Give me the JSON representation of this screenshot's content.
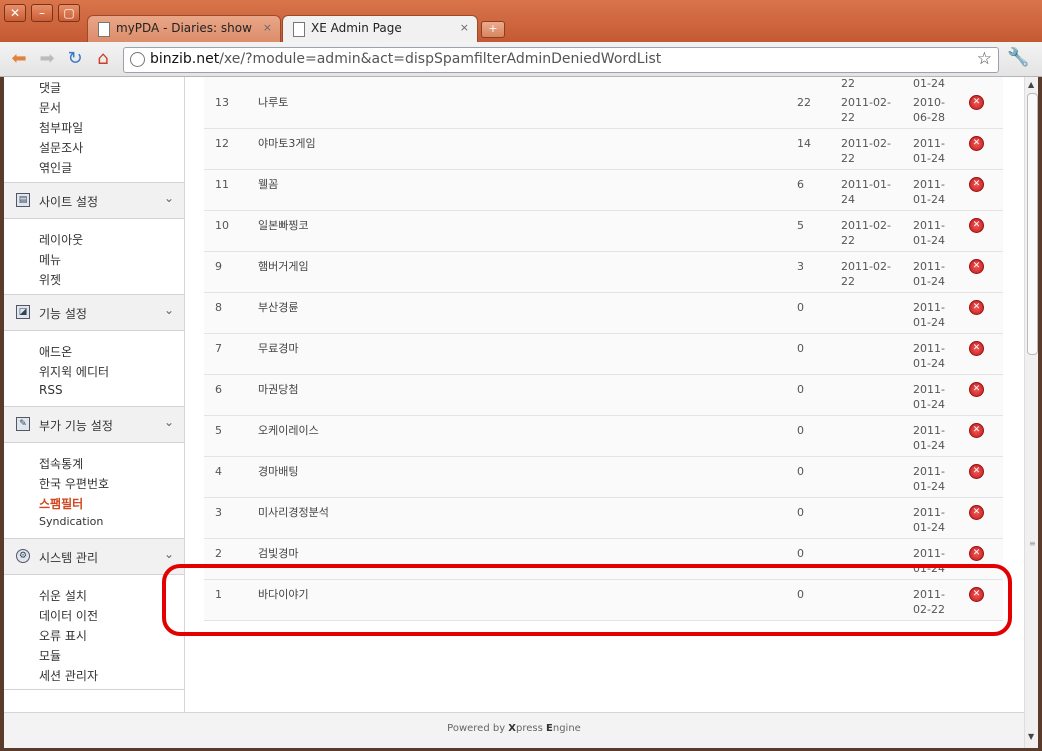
{
  "tabs": [
    {
      "title": "myPDA - Diaries: show",
      "close": "×"
    },
    {
      "title": "XE Admin Page",
      "close": "×"
    }
  ],
  "address": {
    "domain": "binzib.net",
    "path": "/xe/?module=admin&act=dispSpamfilterAdminDeniedWordList"
  },
  "sidebar": {
    "top_items": [
      "댓글",
      "문서",
      "첨부파일",
      "설문조사",
      "엮인글"
    ],
    "sections": [
      {
        "title": "사이트 설정",
        "items": [
          "레이아웃",
          "메뉴",
          "위젯"
        ]
      },
      {
        "title": "기능 설정",
        "items": [
          "애드온",
          "위지윅 에디터",
          "RSS"
        ]
      },
      {
        "title": "부가 기능 설정",
        "items": [
          "접속통계",
          "한국 우편번호",
          "스팸필터",
          "Syndication"
        ]
      },
      {
        "title": "시스템 관리",
        "items": [
          "쉬운 설치",
          "데이터 이전",
          "오류 표시",
          "모듈",
          "세션 관리자"
        ]
      }
    ],
    "active_item": "스팸필터"
  },
  "table": {
    "partial_top_row": {
      "d1": "22",
      "d2": "01-24"
    },
    "rows": [
      {
        "no": "13",
        "word": "나루토",
        "hit": "22",
        "d1": "2011-02-22",
        "d2": "2010-06-28"
      },
      {
        "no": "12",
        "word": "야마토3게임",
        "hit": "14",
        "d1": "2011-02-22",
        "d2": "2011-01-24"
      },
      {
        "no": "11",
        "word": "웰꼼",
        "hit": "6",
        "d1": "2011-01-24",
        "d2": "2011-01-24"
      },
      {
        "no": "10",
        "word": "일본빠찡코",
        "hit": "5",
        "d1": "2011-02-22",
        "d2": "2011-01-24"
      },
      {
        "no": "9",
        "word": "햄버거게임",
        "hit": "3",
        "d1": "2011-02-22",
        "d2": "2011-01-24"
      },
      {
        "no": "8",
        "word": "부산경륜",
        "hit": "0",
        "d1": "",
        "d2": "2011-01-24"
      },
      {
        "no": "7",
        "word": "무료경마",
        "hit": "0",
        "d1": "",
        "d2": "2011-01-24"
      },
      {
        "no": "6",
        "word": "마권당첨",
        "hit": "0",
        "d1": "",
        "d2": "2011-01-24"
      },
      {
        "no": "5",
        "word": "오케이레이스",
        "hit": "0",
        "d1": "",
        "d2": "2011-01-24"
      },
      {
        "no": "4",
        "word": "경마배팅",
        "hit": "0",
        "d1": "",
        "d2": "2011-01-24"
      },
      {
        "no": "3",
        "word": "미사리경정분석",
        "hit": "0",
        "d1": "",
        "d2": "2011-01-24"
      },
      {
        "no": "2",
        "word": "검빛경마",
        "hit": "0",
        "d1": "",
        "d2": "2011-01-24"
      },
      {
        "no": "1",
        "word": "바다이야기",
        "hit": "0",
        "d1": "",
        "d2": "2011-02-22"
      }
    ]
  },
  "footer": {
    "prefix": "Powered by ",
    "brand1": "X",
    "mid": "press ",
    "brand2": "E",
    "suffix": "ngine"
  },
  "colors": {
    "accent": "#d1461e",
    "highlight": "#e30000",
    "chrome": "#c45a33"
  }
}
